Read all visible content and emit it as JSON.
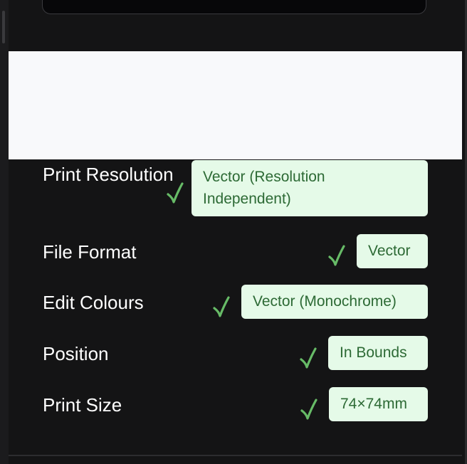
{
  "theme": {
    "background": "#141415",
    "frame_background": "#070709",
    "frame_border": "#3a3a3e",
    "preview_background": "#f8f9fb",
    "text": "#ffffff",
    "check": "#67bb67",
    "chip_background": "#e5fae8",
    "chip_text": "#2d6a35"
  },
  "checks": [
    {
      "label": "Print Resolution",
      "value": "Vector (Resolution Independent)",
      "status_icon": "check-icon",
      "status": "pass"
    },
    {
      "label": "File Format",
      "value": "Vector",
      "status_icon": "check-icon",
      "status": "pass"
    },
    {
      "label": "Edit Colours",
      "value": "Vector (Monochrome)",
      "status_icon": "check-icon",
      "status": "pass"
    },
    {
      "label": "Position",
      "value": "In Bounds",
      "status_icon": "check-icon",
      "status": "pass"
    },
    {
      "label": "Print Size",
      "value": "74×74mm",
      "status_icon": "check-icon",
      "status": "pass"
    }
  ]
}
